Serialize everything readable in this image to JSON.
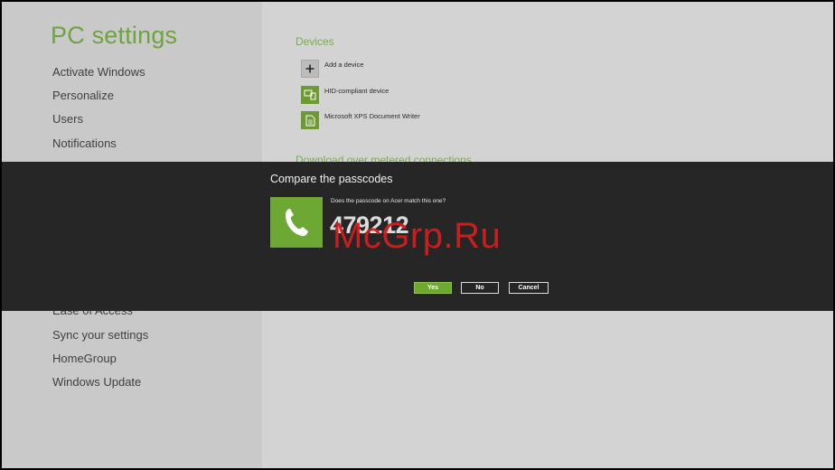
{
  "app": {
    "title": "PC settings"
  },
  "nav": {
    "top": [
      "Activate Windows",
      "Personalize",
      "Users",
      "Notifications"
    ],
    "bottom": [
      "Ease of Access",
      "Sync your settings",
      "HomeGroup",
      "Windows Update"
    ]
  },
  "devices": {
    "heading": "Devices",
    "items": [
      {
        "label": "Add a device",
        "icon": "plus-icon"
      },
      {
        "label": "HID-compliant device",
        "icon": "device-icon"
      },
      {
        "label": "Microsoft XPS Document Writer",
        "icon": "printer-doc-icon"
      }
    ],
    "metered_heading": "Download over metered connections"
  },
  "dialog": {
    "title": "Compare the passcodes",
    "question": "Does the passcode on Acer match this one?",
    "passcode": "479212",
    "icon": "phone-icon",
    "buttons": {
      "yes": "Yes",
      "no": "No",
      "cancel": "Cancel"
    }
  },
  "watermark": "McGrp.Ru",
  "colors": {
    "accent": "#6da53c",
    "dialog_bg": "#262626",
    "left_pane": "#c9c9c9",
    "right_pane": "#d3d3d3",
    "watermark": "#d11e1e"
  }
}
